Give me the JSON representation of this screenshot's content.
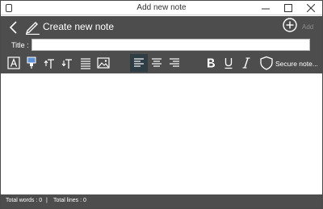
{
  "window": {
    "title": "Add new note"
  },
  "header": {
    "title": "Create new note",
    "add_label": "Add"
  },
  "form": {
    "title_label": "Title :",
    "title_value": "",
    "title_placeholder": ""
  },
  "toolbar": {
    "secure_label": "Secure note...",
    "active_alignment": "align-left"
  },
  "editor": {
    "content": ""
  },
  "status": {
    "words": "Total words : 0",
    "separator": "|",
    "lines": "Total lines : 0"
  },
  "colors": {
    "header_bg": "#4d4d4d",
    "active_tool_bg": "#2f3d45",
    "text_on_dark": "#ffffff"
  }
}
